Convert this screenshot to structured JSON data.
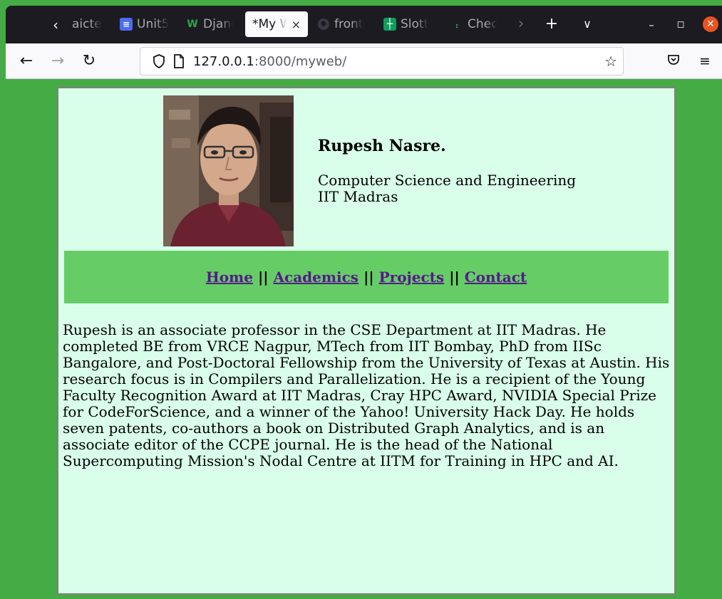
{
  "tabs": [
    {
      "title": "aicte",
      "icon": "none"
    },
    {
      "title": "Unit5",
      "icon": "docs-icon"
    },
    {
      "title": "Djang",
      "icon": "w-icon"
    },
    {
      "title": "*My W",
      "icon": "none",
      "active": true
    },
    {
      "title": "front",
      "icon": "github-icon"
    },
    {
      "title": "Slott",
      "icon": "sheets-icon"
    },
    {
      "title": "Chec",
      "icon": "link-icon"
    }
  ],
  "tab_close": "×",
  "url": {
    "host": "127.0.0.1",
    "rest": ":8000/myweb/"
  },
  "profile": {
    "name": "Rupesh Nasre.",
    "department": "Computer Science and Engineering",
    "institute": "IIT Madras"
  },
  "menu": {
    "home": "Home",
    "academics": "Academics",
    "projects": "Projects",
    "contact": "Contact",
    "separator": "||"
  },
  "bio": "Rupesh is an associate professor in the CSE Department at IIT Madras. He completed BE from VRCE Nagpur, MTech from IIT Bombay, PhD from IISc Bangalore, and Post-Doctoral Fellowship from the University of Texas at Austin. His research focus is in Compilers and Parallelization. He is a recipient of the Young Faculty Recognition Award at IIT Madras, Cray HPC Award, NVIDIA Special Prize for CodeForScience, and a winner of the Yahoo! University Hack Day. He holds seven patents, co-authors a book on Distributed Graph Analytics, and is an associate editor of the CCPE journal. He is the head of the National Supercomputing Mission's Nodal Centre at IITM for Training in HPC and AI.",
  "colors": {
    "page_background": "#45ab44",
    "content_background": "#d9ffea",
    "menu_background": "#66cd66",
    "link": "#551a8b",
    "tabstrip": "#1c1b22",
    "window_close": "#e95420"
  }
}
